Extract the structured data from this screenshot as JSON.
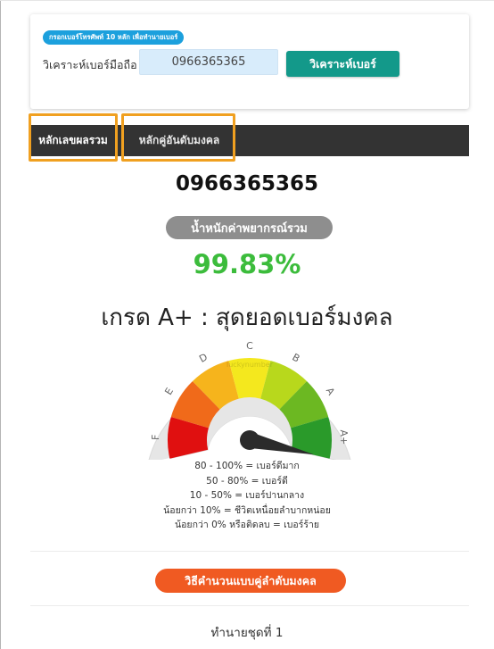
{
  "form": {
    "instruction": "กรอกเบอร์โทรศัพท์ 10 หลัก เพื่อทำนายเบอร์",
    "field_label": "วิเคราะห์เบอร์มือถือ",
    "phone_value": "0966365365",
    "analyze_button": "วิเคราะห์เบอร์"
  },
  "tabs": [
    {
      "label": "หลักเลขผลรวม"
    },
    {
      "label": "หลักคู่อันดับมงคล"
    }
  ],
  "result": {
    "phone_number": "0966365365",
    "weight_label": "น้ำหนักค่าพยากรณ์รวม",
    "score": "99.83%",
    "score_fraction": 0.9983,
    "grade_text": "เกรด A+ : สุดยอดเบอร์มงคล"
  },
  "gauge": {
    "letters": [
      "F",
      "E",
      "D",
      "C",
      "B",
      "A",
      "A+"
    ],
    "zone_colors": [
      "#e01010",
      "#f06a1a",
      "#f6b41c",
      "#f4e81e",
      "#b8d81c",
      "#6cb822",
      "#2a9a2a"
    ],
    "needle_color": "#2b2b2b",
    "watermark": "luckynumber"
  },
  "legend": [
    "80 - 100% = เบอร์ดีมาก",
    "50 - 80% = เบอร์ดี",
    "10 - 50% = เบอร์ปานกลาง",
    "น้อยกว่า 10% = ชีวิตเหนื่อยลำบากหน่อย",
    "น้อยกว่า 0% หรือติดลบ = เบอร์ร้าย"
  ],
  "method_badge": "วิธีคำนวนแบบคู่ลำดับมงคล",
  "prediction_heading": "ทำนายชุดที่ 1",
  "colors": {
    "tab_bar": "#333333",
    "highlight": "#f0a020",
    "score_green": "#3cbc3c",
    "analyze_button": "#13998a",
    "method_badge": "#f05a22",
    "instruction_pill": "#1ca0dd"
  }
}
